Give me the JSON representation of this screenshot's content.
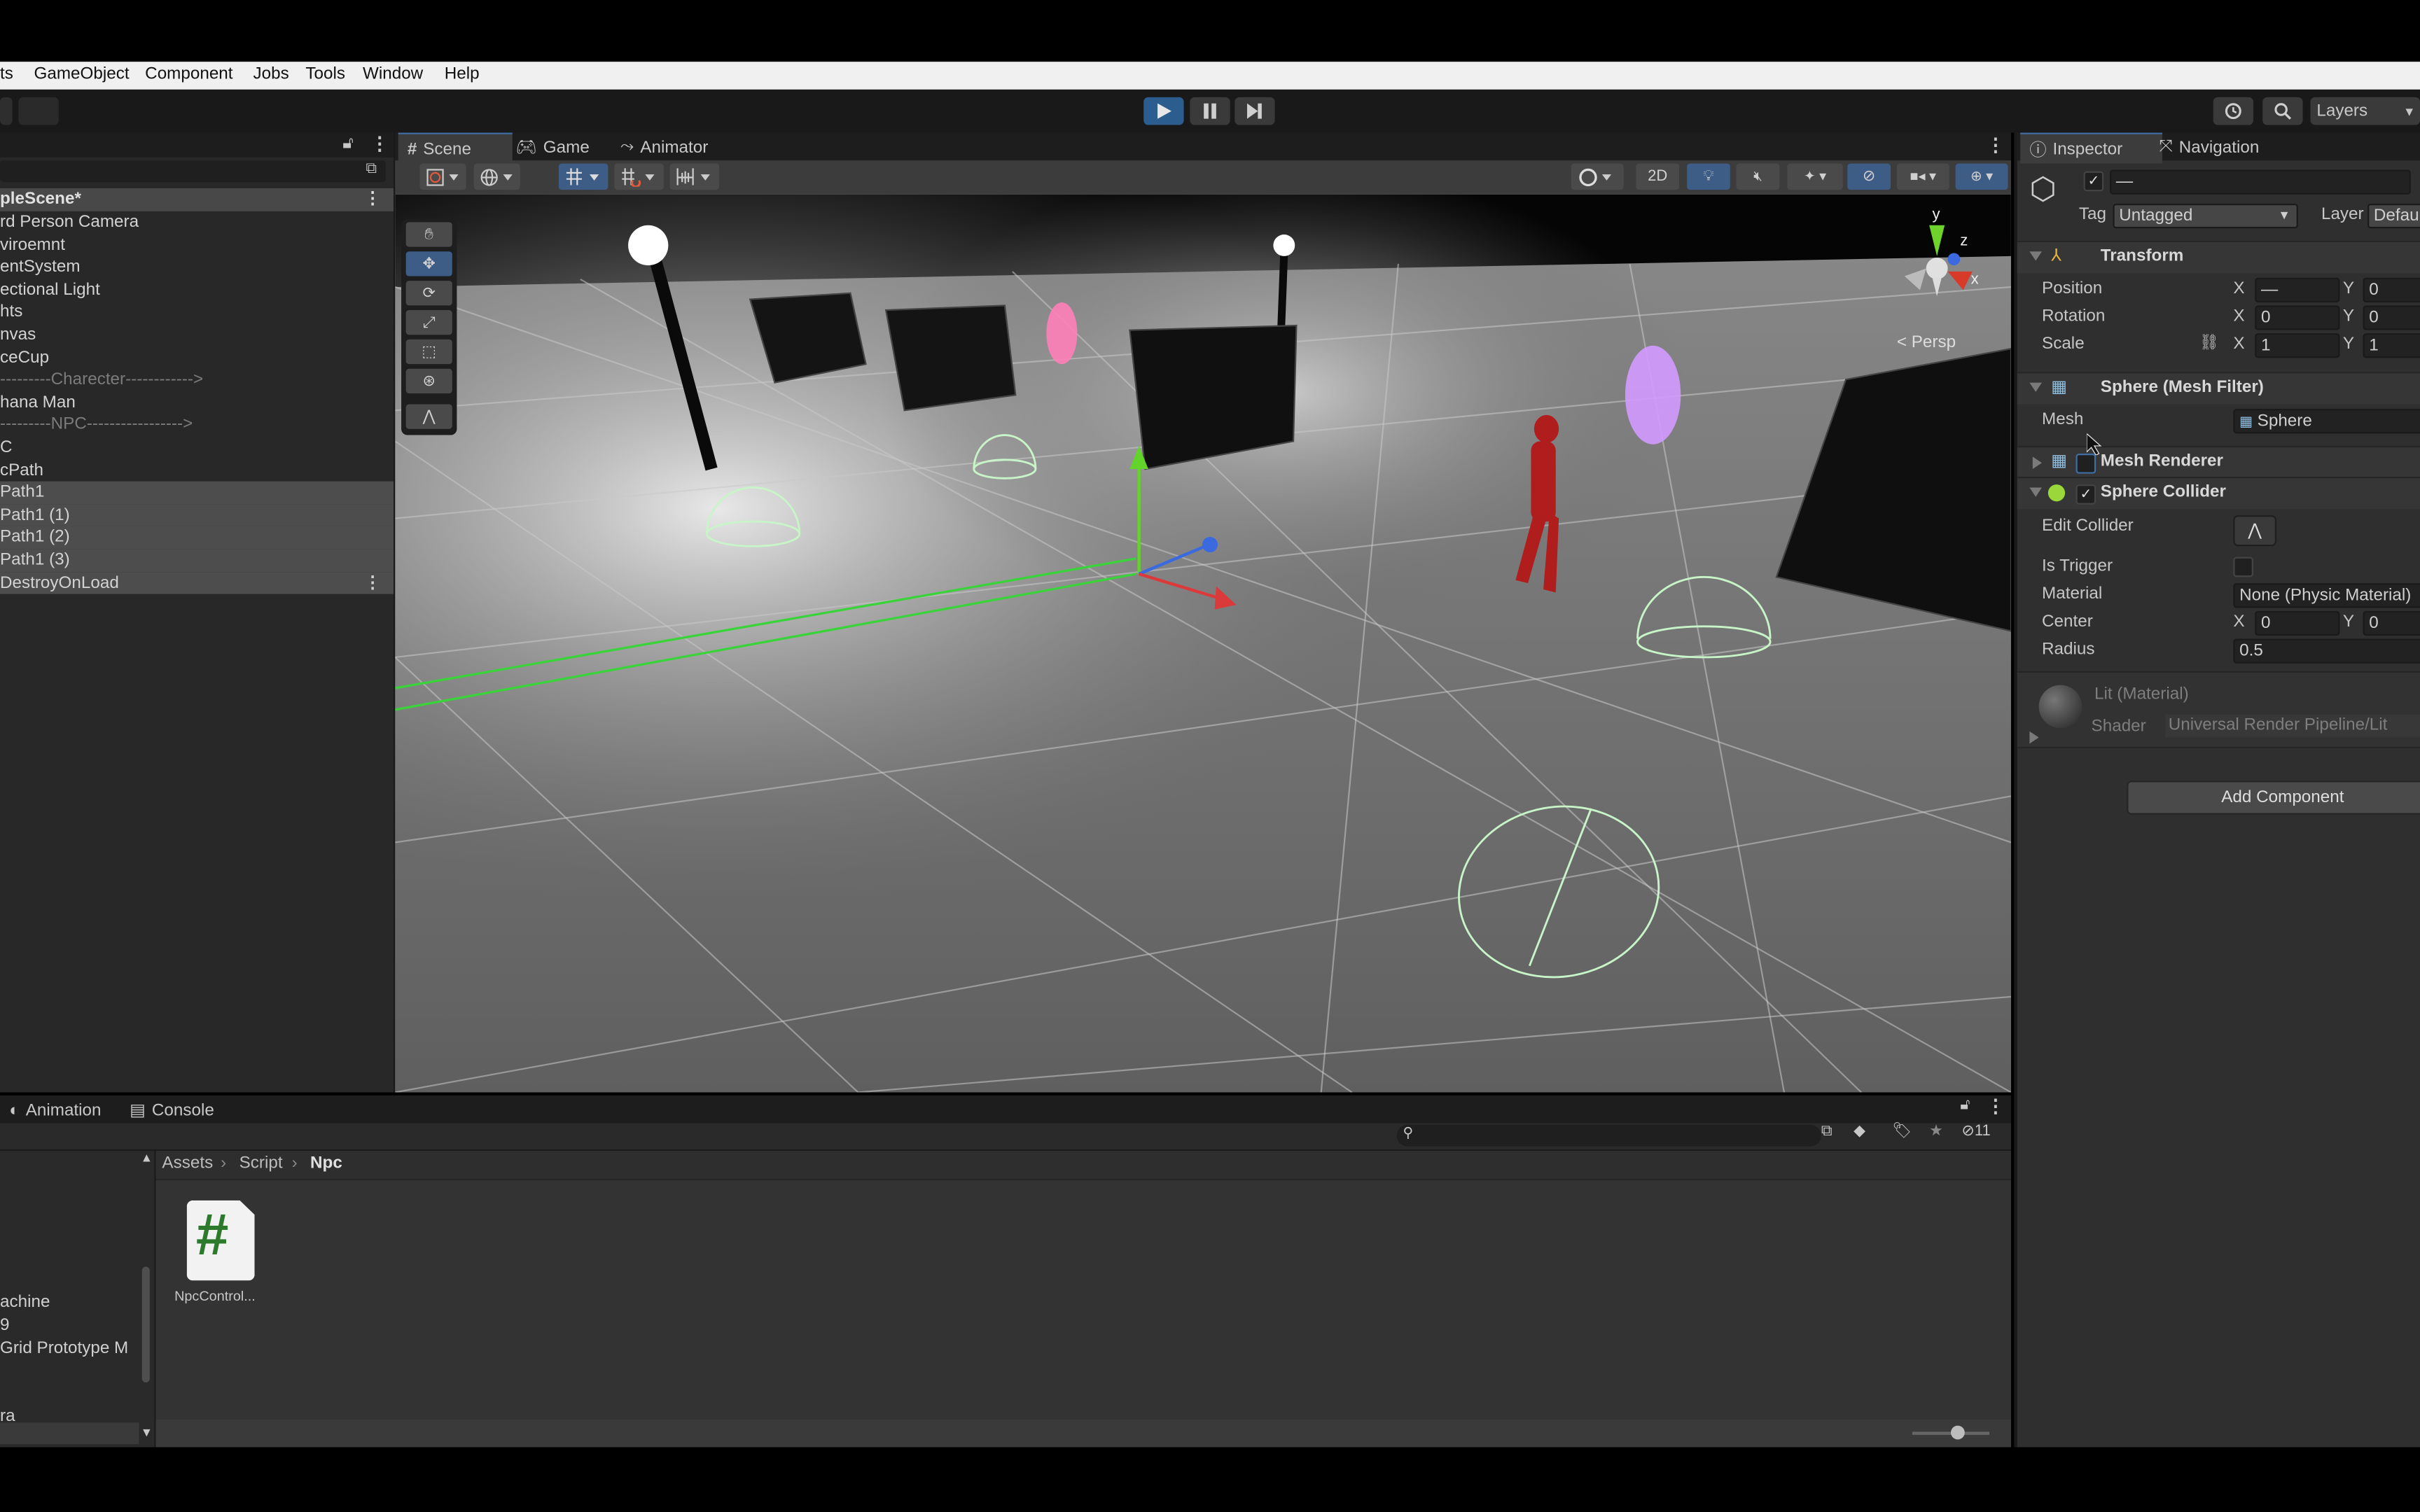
{
  "menu": [
    "ts",
    "GameObject",
    "Component",
    "Jobs",
    "Tools",
    "Window",
    "Help"
  ],
  "toolbar": {
    "play_icon": "play-icon",
    "pause_icon": "pause-icon",
    "step_icon": "step-icon",
    "history_icon": "history-icon",
    "search_icon": "search-icon",
    "layers_label": "Layers"
  },
  "hierarchy": {
    "search_placeholder": "",
    "scene_name": "pleScene*",
    "items": [
      {
        "label": "rd Person Camera",
        "type": "normal"
      },
      {
        "label": "viroemnt",
        "type": "normal"
      },
      {
        "label": "entSystem",
        "type": "normal"
      },
      {
        "label": "ectional Light",
        "type": "normal"
      },
      {
        "label": "hts",
        "type": "normal"
      },
      {
        "label": "nvas",
        "type": "normal"
      },
      {
        "label": "ceCup",
        "type": "normal"
      },
      {
        "label": "---------Charecter------------>",
        "type": "separator"
      },
      {
        "label": "hana Man",
        "type": "normal"
      },
      {
        "label": "---------NPC----------------->",
        "type": "separator"
      },
      {
        "label": "C",
        "type": "normal"
      },
      {
        "label": "cPath",
        "type": "normal"
      },
      {
        "label": "Path1",
        "type": "selected"
      },
      {
        "label": "Path1 (1)",
        "type": "selected"
      },
      {
        "label": "Path1 (2)",
        "type": "selected"
      },
      {
        "label": "Path1 (3)",
        "type": "selected"
      },
      {
        "label": "DestroyOnLoad",
        "type": "selected"
      }
    ]
  },
  "scene": {
    "tabs": [
      {
        "label": "Scene",
        "icon": "grid-hash-icon",
        "active": true
      },
      {
        "label": "Game",
        "icon": "gamepad-icon",
        "active": false
      },
      {
        "label": "Animator",
        "icon": "animator-icon",
        "active": false
      }
    ],
    "toolbar_right": {
      "two_d_label": "2D"
    },
    "gizmo": {
      "y_label": "y",
      "z_label": "z",
      "x_label": "x",
      "projection_label": "Persp"
    }
  },
  "inspector": {
    "tabs": [
      {
        "label": "Inspector",
        "icon": "info-icon",
        "active": true
      },
      {
        "label": "Navigation",
        "icon": "navigation-icon",
        "active": false
      }
    ],
    "object_name": "—",
    "active": true,
    "tag_label": "Tag",
    "tag_value": "Untagged",
    "layer_label": "Layer",
    "layer_value": "Defau",
    "transform": {
      "title": "Transform",
      "position": {
        "label": "Position",
        "x": "—",
        "y": "0"
      },
      "rotation": {
        "label": "Rotation",
        "x": "0",
        "y": "0"
      },
      "scale": {
        "label": "Scale",
        "x": "1",
        "y": "1"
      }
    },
    "mesh_filter": {
      "title": "Sphere (Mesh Filter)",
      "mesh_label": "Mesh",
      "mesh_value": "Sphere"
    },
    "mesh_renderer": {
      "title": "Mesh Renderer",
      "enabled": false
    },
    "sphere_collider": {
      "title": "Sphere Collider",
      "enabled": true,
      "edit_collider_label": "Edit Collider",
      "is_trigger_label": "Is Trigger",
      "is_trigger": false,
      "material_label": "Material",
      "material_value": "None (Physic Material)",
      "center_label": "Center",
      "center_x": "0",
      "center_y": "0",
      "radius_label": "Radius",
      "radius_value": "0.5"
    },
    "material": {
      "title": "Lit (Material)",
      "shader_label": "Shader",
      "shader_value": "Universal Render Pipeline/Lit"
    },
    "add_component_label": "Add Component",
    "axis_x": "X",
    "axis_y": "Y"
  },
  "bottom": {
    "tabs": [
      {
        "label": "Animation",
        "icon": "animation-icon"
      },
      {
        "label": "Console",
        "icon": "console-icon"
      }
    ],
    "search_placeholder": "",
    "hidden_count": "11",
    "breadcrumb": [
      "Assets",
      "Script",
      "Npc"
    ],
    "folders": [
      "",
      "",
      "",
      "achine",
      "9",
      "Grid Prototype M",
      "",
      "ra"
    ],
    "assets": [
      {
        "name": "NpcControl...",
        "icon": "csharp-script-icon"
      }
    ],
    "icon_size_slider": 0.58
  }
}
